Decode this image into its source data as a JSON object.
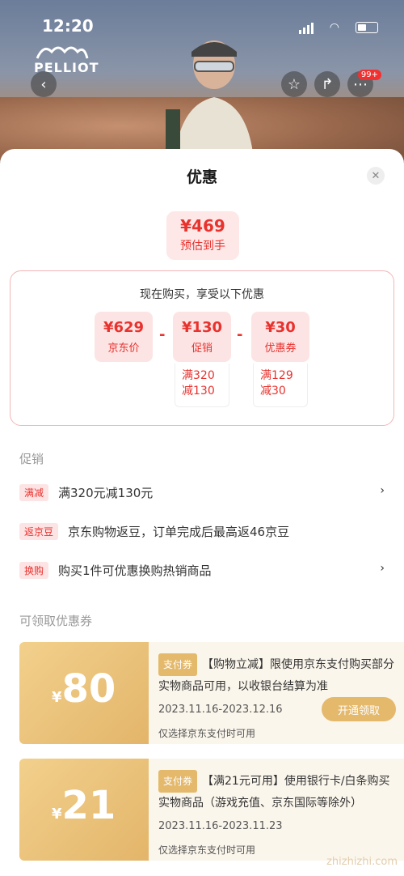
{
  "status_bar": {
    "time": "12:20"
  },
  "hero": {
    "brand": "PELLIOT",
    "badge": "99+"
  },
  "sheet": {
    "title": "优惠",
    "estimate": {
      "price": "¥469",
      "label": "预估到手"
    },
    "breakdown": {
      "heading": "现在购买，享受以下优惠",
      "items": [
        {
          "value": "¥629",
          "label": "京东价"
        },
        {
          "value": "¥130",
          "label": "促销",
          "cond_line1": "满320",
          "cond_line2": "减130"
        },
        {
          "value": "¥30",
          "label": "优惠券",
          "cond_line1": "满129",
          "cond_line2": "减30"
        }
      ],
      "operator": "-"
    },
    "promo_section": "促销",
    "promos": [
      {
        "tag": "满减",
        "text": "满320元减130元",
        "chevron": "›"
      },
      {
        "tag": "返京豆",
        "text": "京东购物返豆，订单完成后最高返46京豆"
      },
      {
        "tag": "换购",
        "text": "购买1件可优惠换购热销商品",
        "chevron": "›"
      }
    ],
    "coupon_section": "可领取优惠券",
    "coupons": [
      {
        "symbol": "¥",
        "amount": "80",
        "tag": "支付券",
        "desc": "【购物立减】限使用京东支付购买部分实物商品可用，以收银台结算为准",
        "date": "2023.11.16-2023.12.16",
        "note": "仅选择京东支付时可用",
        "button": "开通领取"
      },
      {
        "symbol": "¥",
        "amount": "21",
        "tag": "支付券",
        "desc": "【满21元可用】使用银行卡/白条购买实物商品（游戏充值、京东国际等除外）",
        "date": "2023.11.16-2023.11.23",
        "note": "仅选择京东支付时可用"
      }
    ]
  },
  "watermark": "zhizhizhi.com"
}
